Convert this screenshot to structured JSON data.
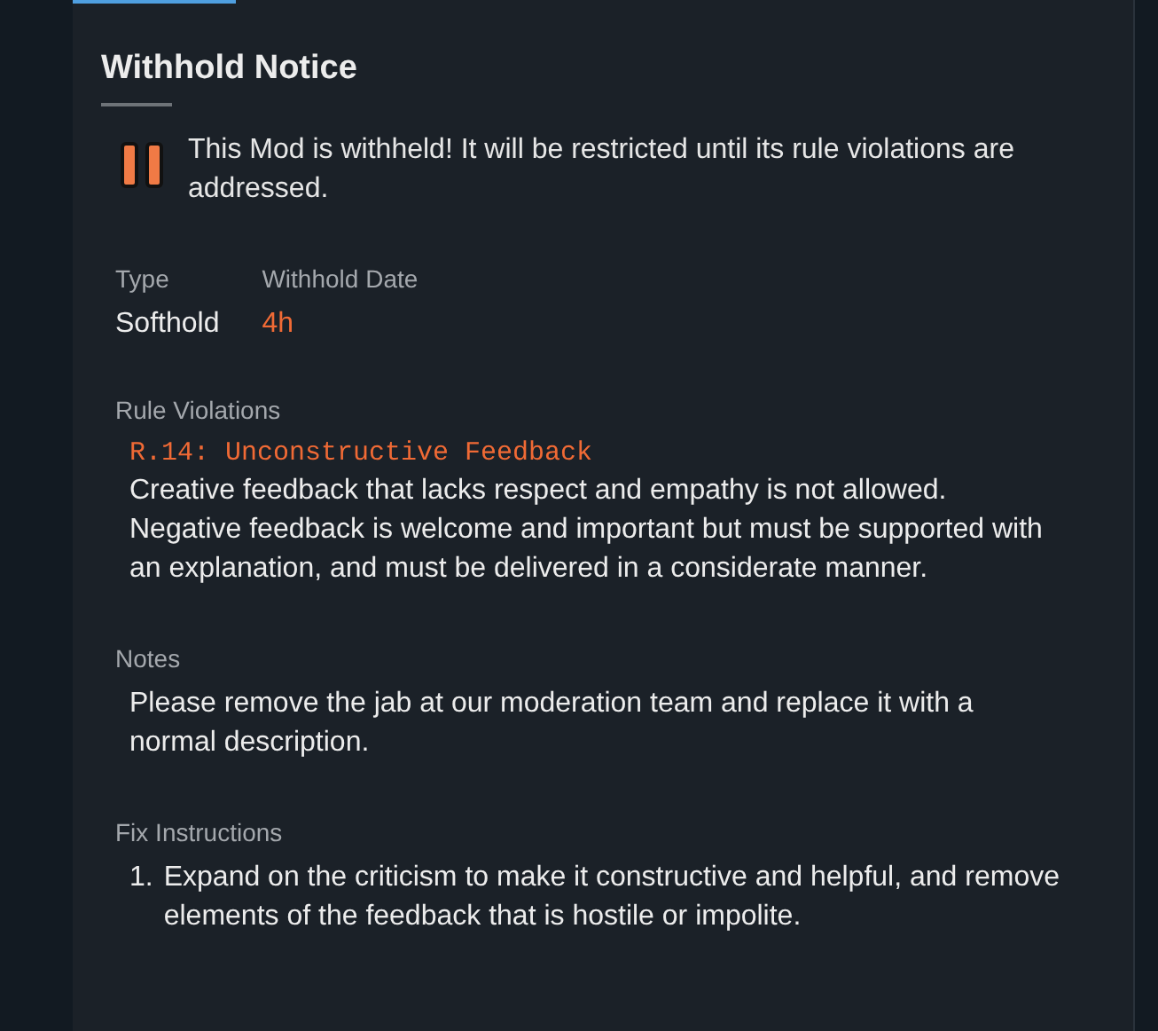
{
  "title": "Withhold Notice",
  "notice": "This Mod is withheld! It will be restricted until its rule violations are addressed.",
  "details": [
    {
      "label": "Type",
      "value": "Softhold",
      "kind": "plain"
    },
    {
      "label": "Withhold Date",
      "value": "4h",
      "kind": "accent"
    }
  ],
  "rule_violations": {
    "label": "Rule Violations",
    "items": [
      {
        "rule": "R.14: Unconstructive Feedback",
        "description": "Creative feedback that lacks respect and empathy is not allowed. Negative feedback is welcome and important but must be supported with an explanation, and must be delivered in a considerate manner."
      }
    ]
  },
  "notes": {
    "label": "Notes",
    "text": "Please remove the jab at our moderation team and replace it with a normal description."
  },
  "fix_instructions": {
    "label": "Fix Instructions",
    "items": [
      {
        "number": "1.",
        "text": "Expand on the criticism to make it constructive and helpful, and remove elements of the feedback that is hostile or impolite."
      }
    ]
  }
}
